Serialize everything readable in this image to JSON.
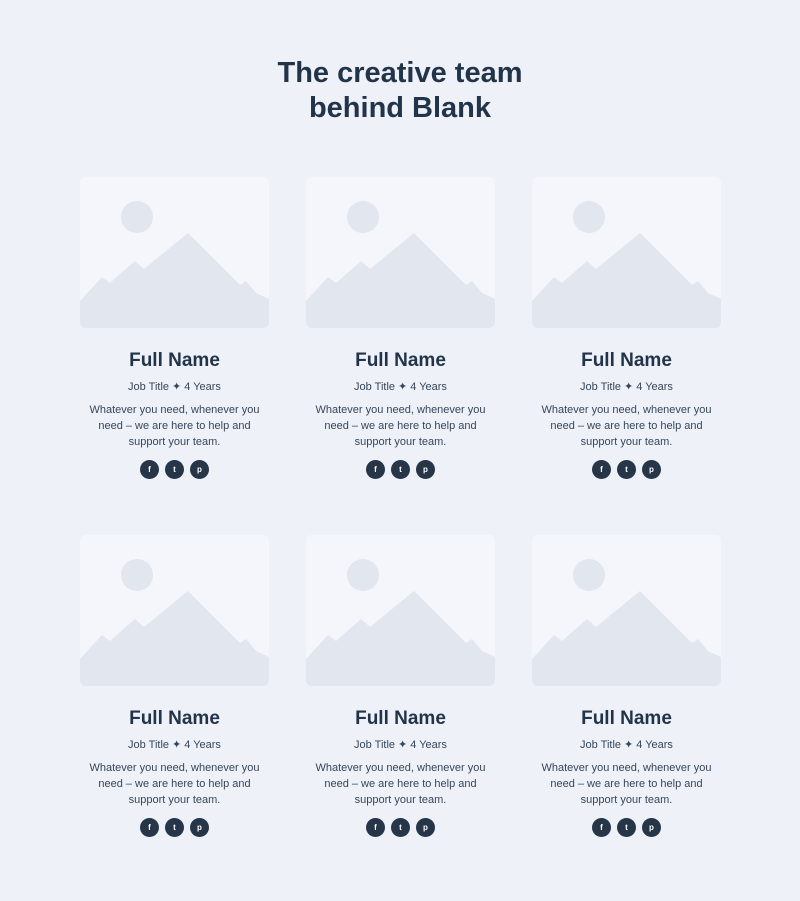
{
  "section": {
    "title_line1": "The creative team",
    "title_line2": "behind Blank"
  },
  "colors": {
    "background": "#eff1f8",
    "heading": "#22344a",
    "body_text": "#35465a",
    "social_button": "#263548",
    "placeholder_bg": "#f4f6fb",
    "placeholder_shape": "#e1e6ef"
  },
  "team": [
    {
      "name": "Full Name",
      "job_title": "Job Title",
      "separator": "✦",
      "experience": "4 Years",
      "bio": "Whatever you need, whenever you need – we are here to help and support your team.",
      "image": "image-placeholder-icon",
      "social": [
        {
          "icon": "facebook-icon",
          "glyph": "f"
        },
        {
          "icon": "twitter-icon",
          "glyph": "t"
        },
        {
          "icon": "pinterest-icon",
          "glyph": "p"
        }
      ]
    },
    {
      "name": "Full Name",
      "job_title": "Job Title",
      "separator": "✦",
      "experience": "4 Years",
      "bio": "Whatever you need, whenever you need – we are here to help and support your team.",
      "image": "image-placeholder-icon",
      "social": [
        {
          "icon": "facebook-icon",
          "glyph": "f"
        },
        {
          "icon": "twitter-icon",
          "glyph": "t"
        },
        {
          "icon": "pinterest-icon",
          "glyph": "p"
        }
      ]
    },
    {
      "name": "Full Name",
      "job_title": "Job Title",
      "separator": "✦",
      "experience": "4 Years",
      "bio": "Whatever you need, whenever you need – we are here to help and support your team.",
      "image": "image-placeholder-icon",
      "social": [
        {
          "icon": "facebook-icon",
          "glyph": "f"
        },
        {
          "icon": "twitter-icon",
          "glyph": "t"
        },
        {
          "icon": "pinterest-icon",
          "glyph": "p"
        }
      ]
    },
    {
      "name": "Full Name",
      "job_title": "Job Title",
      "separator": "✦",
      "experience": "4 Years",
      "bio": "Whatever you need, whenever you need – we are here to help and support your team.",
      "image": "image-placeholder-icon",
      "social": [
        {
          "icon": "facebook-icon",
          "glyph": "f"
        },
        {
          "icon": "twitter-icon",
          "glyph": "t"
        },
        {
          "icon": "pinterest-icon",
          "glyph": "p"
        }
      ]
    },
    {
      "name": "Full Name",
      "job_title": "Job Title",
      "separator": "✦",
      "experience": "4 Years",
      "bio": "Whatever you need, whenever you need – we are here to help and support your team.",
      "image": "image-placeholder-icon",
      "social": [
        {
          "icon": "facebook-icon",
          "glyph": "f"
        },
        {
          "icon": "twitter-icon",
          "glyph": "t"
        },
        {
          "icon": "pinterest-icon",
          "glyph": "p"
        }
      ]
    },
    {
      "name": "Full Name",
      "job_title": "Job Title",
      "separator": "✦",
      "experience": "4 Years",
      "bio": "Whatever you need, whenever you need – we are here to help and support your team.",
      "image": "image-placeholder-icon",
      "social": [
        {
          "icon": "facebook-icon",
          "glyph": "f"
        },
        {
          "icon": "twitter-icon",
          "glyph": "t"
        },
        {
          "icon": "pinterest-icon",
          "glyph": "p"
        }
      ]
    }
  ]
}
